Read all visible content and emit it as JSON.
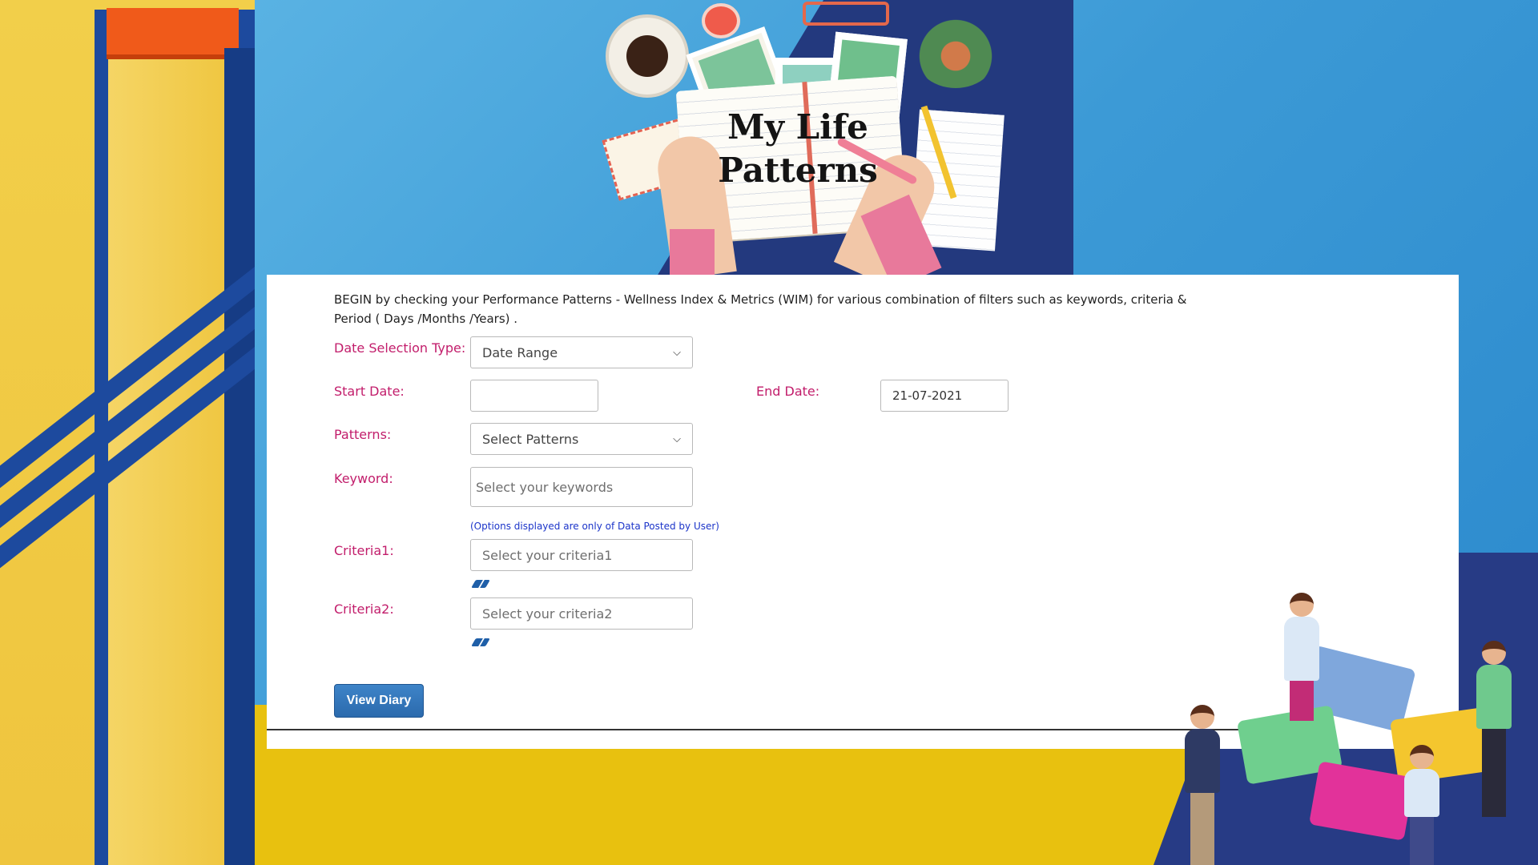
{
  "hero": {
    "title_line1": "My Life",
    "title_line2": "Patterns"
  },
  "form": {
    "intro_line1": "BEGIN by checking your Performance Patterns - Wellness Index & Metrics (WIM) for various combination of filters such as keywords, criteria &",
    "intro_line2": "Period ( Days /Months /Years) .",
    "date_selection_type": {
      "label": "Date Selection Type:",
      "value": "Date Range"
    },
    "start_date": {
      "label": "Start Date:",
      "value": ""
    },
    "end_date": {
      "label": "End Date:",
      "value": "21-07-2021"
    },
    "patterns": {
      "label": "Patterns:",
      "value": "Select Patterns"
    },
    "keyword": {
      "label": "Keyword:",
      "placeholder": "Select your keywords"
    },
    "hint": "(Options displayed are only of Data Posted by User)",
    "criteria1": {
      "label": "Criteria1:",
      "placeholder": "Select your criteria1"
    },
    "criteria2": {
      "label": "Criteria2:",
      "placeholder": "Select your criteria2"
    },
    "submit_label": "View Diary"
  },
  "colors": {
    "label": "#c21d6b",
    "hint": "#1b34c9",
    "button": "#2b6aad",
    "eraser_icon": "#1f5fa8"
  },
  "icons": {
    "select_arrow": "chevron-down-icon",
    "clear": "eraser-icon"
  }
}
